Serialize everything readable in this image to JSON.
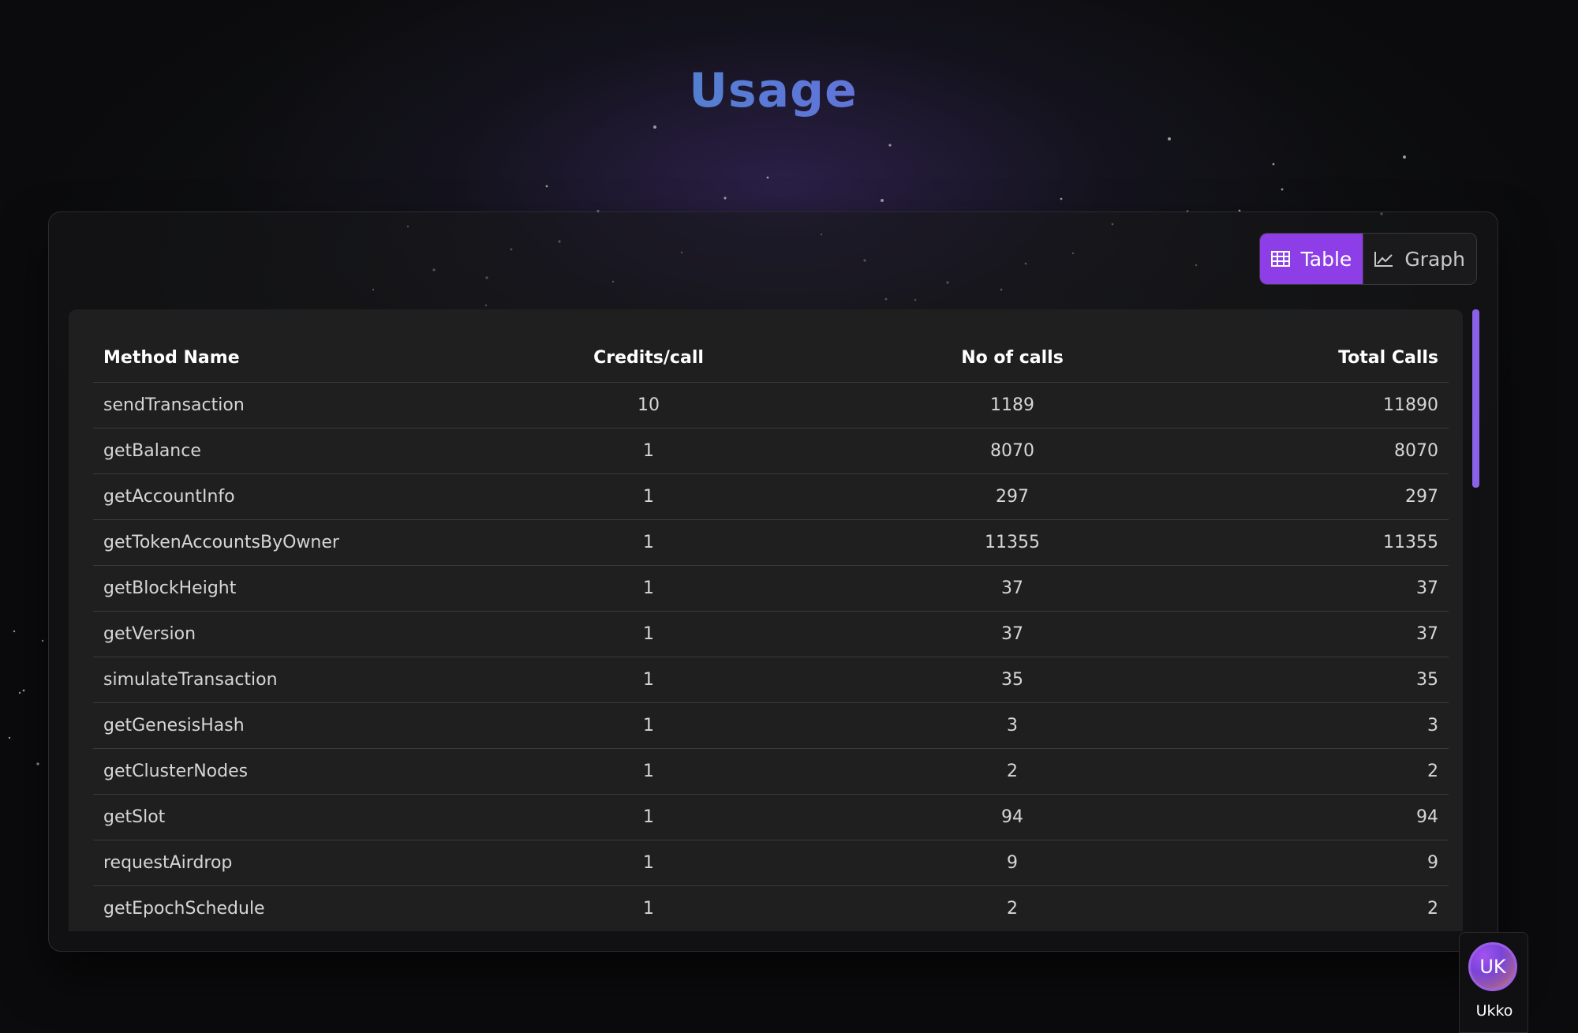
{
  "page": {
    "title": "Usage"
  },
  "view_toggle": {
    "options": [
      {
        "label": "Table",
        "icon": "table-icon",
        "active": true
      },
      {
        "label": "Graph",
        "icon": "line-chart-icon",
        "active": false
      }
    ]
  },
  "table": {
    "headers": [
      "Method Name",
      "Credits/call",
      "No of calls",
      "Total Calls"
    ],
    "rows": [
      [
        "sendTransaction",
        "10",
        "1189",
        "11890"
      ],
      [
        "getBalance",
        "1",
        "8070",
        "8070"
      ],
      [
        "getAccountInfo",
        "1",
        "297",
        "297"
      ],
      [
        "getTokenAccountsByOwner",
        "1",
        "11355",
        "11355"
      ],
      [
        "getBlockHeight",
        "1",
        "37",
        "37"
      ],
      [
        "getVersion",
        "1",
        "37",
        "37"
      ],
      [
        "simulateTransaction",
        "1",
        "35",
        "35"
      ],
      [
        "getGenesisHash",
        "1",
        "3",
        "3"
      ],
      [
        "getClusterNodes",
        "1",
        "2",
        "2"
      ],
      [
        "getSlot",
        "1",
        "94",
        "94"
      ],
      [
        "requestAirdrop",
        "1",
        "9",
        "9"
      ],
      [
        "getEpochSchedule",
        "1",
        "2",
        "2"
      ]
    ]
  },
  "user": {
    "initials": "UK",
    "name": "Ukko"
  },
  "colors": {
    "accent": "#8d3ee6",
    "title_gradient_start": "#1fb59a",
    "title_gradient_end": "#a64bea",
    "scrollbar": "#8a62e8"
  }
}
